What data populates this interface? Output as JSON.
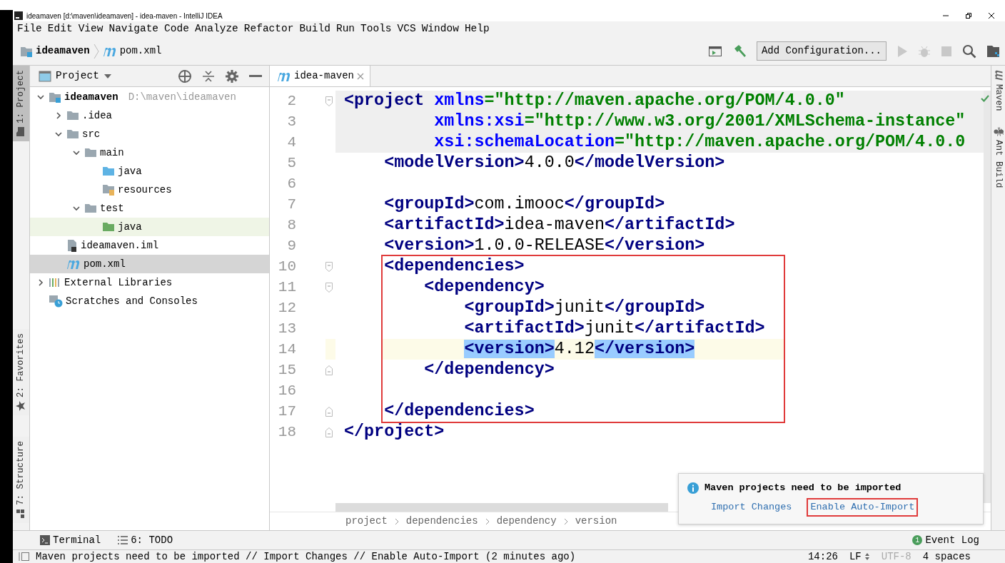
{
  "window": {
    "title": "ideamaven [d:\\maven\\ideamaven] - idea-maven - IntelliJ IDEA"
  },
  "menu": [
    "File",
    "Edit",
    "View",
    "Navigate",
    "Code",
    "Analyze",
    "Refactor",
    "Build",
    "Run",
    "Tools",
    "VCS",
    "Window",
    "Help"
  ],
  "nav_bar": {
    "crumbs": [
      {
        "label": "ideamaven",
        "kind": "module"
      },
      {
        "label": "pom.xml",
        "kind": "maven"
      }
    ],
    "run_config": "Add Configuration...",
    "tools": [
      {
        "kind": "run-window",
        "disabled": false
      },
      {
        "kind": "build",
        "disabled": false
      },
      {
        "kind": "run",
        "disabled": true
      },
      {
        "kind": "debug",
        "disabled": true
      },
      {
        "kind": "stop",
        "disabled": true
      },
      {
        "kind": "search",
        "disabled": false
      },
      {
        "kind": "structure",
        "disabled": false
      }
    ]
  },
  "left_strip": [
    {
      "label": "1: Project",
      "kind": "project",
      "selected": true
    },
    {
      "label": "2: Favorites",
      "kind": "favorites",
      "selected": false
    },
    {
      "label": "7: Structure",
      "kind": "structure",
      "selected": false
    }
  ],
  "right_strip": [
    {
      "label": "Maven",
      "kind": "maven"
    },
    {
      "label": "Ant Build",
      "kind": "ant"
    }
  ],
  "project_panel": {
    "title": "Project",
    "tree": [
      {
        "label": "ideamaven",
        "hint": "D:\\maven\\ideamaven",
        "kind": "module",
        "expanded": true,
        "selected": false,
        "children": [
          {
            "label": ".idea",
            "kind": "folder",
            "expanded": false,
            "selected": false
          },
          {
            "label": "src",
            "kind": "folder",
            "expanded": true,
            "selected": false,
            "children": [
              {
                "label": "main",
                "kind": "folder",
                "expanded": true,
                "selected": false,
                "children": [
                  {
                    "label": "java",
                    "kind": "source",
                    "selected": false
                  },
                  {
                    "label": "resources",
                    "kind": "resources",
                    "selected": false
                  }
                ]
              },
              {
                "label": "test",
                "kind": "folder",
                "expanded": true,
                "selected": false,
                "children": [
                  {
                    "label": "java",
                    "kind": "test",
                    "selected": false,
                    "highlighted": true
                  }
                ]
              }
            ]
          },
          {
            "label": "ideamaven.iml",
            "kind": "iml",
            "selected": false
          },
          {
            "label": "pom.xml",
            "kind": "maven",
            "selected": true
          }
        ]
      },
      {
        "label": "External Libraries",
        "kind": "libraries",
        "expanded": false,
        "selected": false
      },
      {
        "label": "Scratches and Consoles",
        "kind": "scratches",
        "selected": false
      }
    ]
  },
  "editor": {
    "tabs": [
      {
        "label": "idea-maven",
        "selected": true
      }
    ],
    "lines": [
      {
        "number": "2",
        "shade": true,
        "tokens": [
          {
            "kind": "tag",
            "text": "<project"
          },
          {
            "kind": "attr",
            "text": " xmlns"
          },
          {
            "kind": "value",
            "text": "=\"http://maven.apache.org/POM/4.0.0\""
          }
        ],
        "continuation": [
          {
            "number": "3",
            "shade": true,
            "tokens": [
              {
                "kind": "attr",
                "text": "xmlns:xsi"
              },
              {
                "kind": "value",
                "text": "=\"http://www.w3.org/2001/XMLSchema-instance\""
              }
            ]
          },
          {
            "number": "4",
            "shade": true,
            "tokens": [
              {
                "kind": "attr",
                "text": "xsi:schemaLocation"
              },
              {
                "kind": "value",
                "text": "=\"http://maven.apache.org/POM/4.0.0"
              }
            ]
          }
        ],
        "children": [
          {
            "number": "5",
            "framed": false,
            "tokens": [
              {
                "kind": "tag",
                "text": "<modelVersion>"
              },
              {
                "kind": "text",
                "text": "4.0.0"
              },
              {
                "kind": "tag",
                "text": "</modelVersion>"
              }
            ]
          },
          {
            "number": "6",
            "framed": false
          },
          {
            "number": "7",
            "framed": false,
            "tokens": [
              {
                "kind": "tag",
                "text": "<groupId>"
              },
              {
                "kind": "text",
                "text": "com.imooc"
              },
              {
                "kind": "tag",
                "text": "</groupId>"
              }
            ]
          },
          {
            "number": "8",
            "framed": false,
            "tokens": [
              {
                "kind": "tag",
                "text": "<artifactId>"
              },
              {
                "kind": "text",
                "text": "idea-maven"
              },
              {
                "kind": "tag",
                "text": "</artifactId>"
              }
            ]
          },
          {
            "number": "9",
            "framed": false,
            "tokens": [
              {
                "kind": "tag",
                "text": "<version>"
              },
              {
                "kind": "text",
                "text": "1.0.0-RELEASE"
              },
              {
                "kind": "tag",
                "text": "</version>"
              }
            ]
          },
          {
            "number": "10",
            "framed": true,
            "tokens": [
              {
                "kind": "tag",
                "text": "<dependencies>"
              }
            ],
            "children": [
              {
                "number": "11",
                "tokens": [
                  {
                    "kind": "tag",
                    "text": "<dependency>"
                  }
                ],
                "children": [
                  {
                    "number": "12",
                    "tokens": [
                      {
                        "kind": "tag",
                        "text": "<groupId>"
                      },
                      {
                        "kind": "text",
                        "text": "junit"
                      },
                      {
                        "kind": "tag",
                        "text": "</groupId>"
                      }
                    ]
                  },
                  {
                    "number": "13",
                    "tokens": [
                      {
                        "kind": "tag",
                        "text": "<artifactId>"
                      },
                      {
                        "kind": "text",
                        "text": "junit"
                      },
                      {
                        "kind": "tag",
                        "text": "</artifactId>"
                      }
                    ]
                  },
                  {
                    "number": "14",
                    "current": true,
                    "tokens": [
                      {
                        "kind": "tag",
                        "text": "<version>",
                        "match": true
                      },
                      {
                        "kind": "text",
                        "text": "4.12"
                      },
                      {
                        "kind": "tag",
                        "text": "</version>",
                        "match": true
                      }
                    ]
                  }
                ],
                "closing": {
                  "number": "15",
                  "tokens": [
                    {
                      "kind": "tag",
                      "text": "</dependency>"
                    }
                  ]
                }
              },
              {
                "number": "16"
              }
            ],
            "closing": {
              "number": "17",
              "tokens": [
                {
                  "kind": "tag",
                  "text": "</dependencies>"
                }
              ]
            }
          }
        ],
        "closing": {
          "number": "18",
          "tokens": [
            {
              "kind": "tag",
              "text": "</project>"
            }
          ]
        }
      }
    ],
    "breadcrumbs": [
      "project",
      "dependencies",
      "dependency",
      "version"
    ]
  },
  "notification": {
    "title": "Maven projects need to be imported",
    "links": [
      {
        "label": "Import Changes",
        "framed": false
      },
      {
        "label": "Enable Auto-Import",
        "framed": true
      }
    ]
  },
  "bottom_tools": [
    {
      "label": "Terminal",
      "kind": "terminal"
    },
    {
      "label": "6: TODO",
      "kind": "todo"
    }
  ],
  "event_log": {
    "label": "Event Log",
    "count": "1"
  },
  "status_bar": {
    "message": "Maven projects need to be imported // Import Changes // Enable Auto-Import (2 minutes ago)",
    "items": [
      {
        "label": "14:26",
        "disabled": false
      },
      {
        "label": "LF",
        "disabled": false,
        "kind": "updown"
      },
      {
        "label": "UTF-8",
        "disabled": true
      },
      {
        "label": "4 spaces",
        "disabled": false
      }
    ]
  }
}
